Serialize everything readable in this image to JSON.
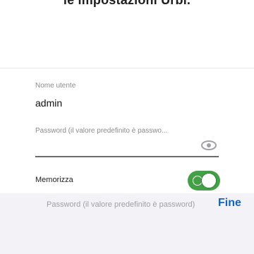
{
  "header": {
    "partial_text": "le impostazioni Urbi."
  },
  "form": {
    "username": {
      "label": "Nome utente",
      "value": "admin"
    },
    "password": {
      "placeholder": "Password (il valore predefinito è passwo...",
      "value": "",
      "visibility_icon": "eye-icon"
    },
    "remember": {
      "label": "Memorizza",
      "checked": true
    }
  },
  "keyboard_bar": {
    "hint": "Password (il valore predefinito è password)",
    "done_label": "Fine"
  },
  "colors": {
    "toggle_on": "#43a047",
    "done_button": "#1565c0"
  }
}
